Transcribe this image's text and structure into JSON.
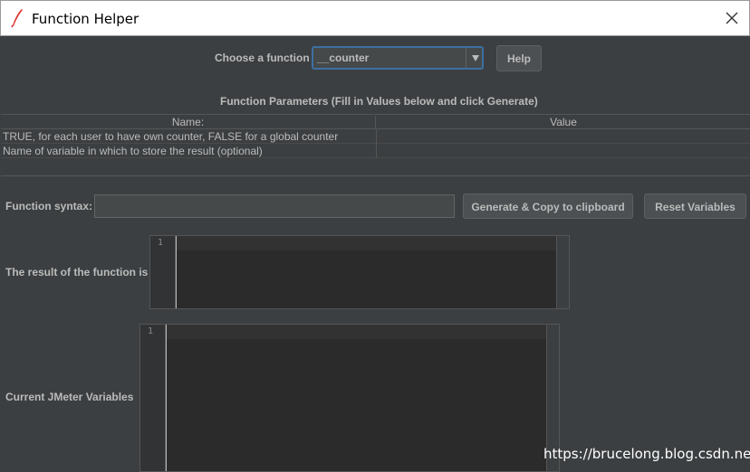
{
  "window": {
    "title": "Function Helper"
  },
  "chooser": {
    "label": "Choose a function",
    "selected": "__counter",
    "help_label": "Help"
  },
  "params": {
    "heading": "Function Parameters (Fill in Values below and click Generate)",
    "columns": [
      "Name:",
      "Value"
    ],
    "rows": [
      {
        "name": "TRUE, for each user to have own counter, FALSE for a global counter",
        "value": ""
      },
      {
        "name": "Name of variable in which to store the result (optional)",
        "value": ""
      }
    ]
  },
  "syntax": {
    "label": "Function syntax:",
    "value": "",
    "generate_label": "Generate & Copy to clipboard",
    "reset_label": "Reset Variables"
  },
  "result": {
    "label": "The result of the function is",
    "line_number": "1"
  },
  "variables": {
    "label": "Current JMeter Variables",
    "line_number": "1"
  },
  "watermark": "https://brucelong.blog.csdn.net",
  "colors": {
    "background": "#3c3f41",
    "editor": "#2b2b2b",
    "focus_border": "#3d6fa3",
    "icon": "#e0312b"
  },
  "icons": {
    "app": "feather-icon",
    "close": "close-icon",
    "dropdown": "triangle-down-icon"
  }
}
